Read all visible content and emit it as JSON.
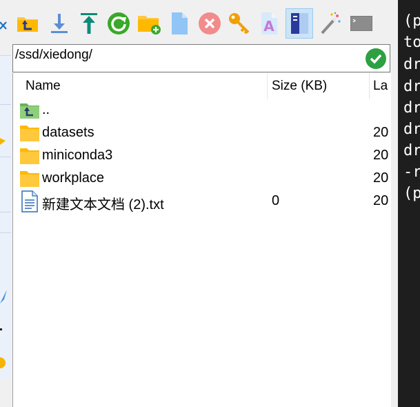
{
  "path": {
    "value": "/ssd/xiedong/"
  },
  "columns": {
    "name": "Name",
    "size": "Size (KB)",
    "date": "La"
  },
  "files": [
    {
      "name": "..",
      "size": "",
      "date": "",
      "icon": "parent-folder-icon"
    },
    {
      "name": "datasets",
      "size": "",
      "date": "20",
      "icon": "folder-icon"
    },
    {
      "name": "miniconda3",
      "size": "",
      "date": "20",
      "icon": "folder-icon"
    },
    {
      "name": "workplace",
      "size": "",
      "date": "20",
      "icon": "folder-icon"
    },
    {
      "name": "新建文本文档 (2).txt",
      "size": "0",
      "date": "20",
      "icon": "text-file-icon"
    }
  ],
  "terminal": {
    "lines": [
      "(p",
      "to",
      "dr",
      "dr",
      "dr",
      "dr",
      "dr",
      "-r",
      "(p"
    ]
  },
  "colors": {
    "accent": "#99c9ef",
    "folder": "#ffc83d",
    "go": "#2ea043",
    "terminal_bg": "#1e1e1e"
  }
}
